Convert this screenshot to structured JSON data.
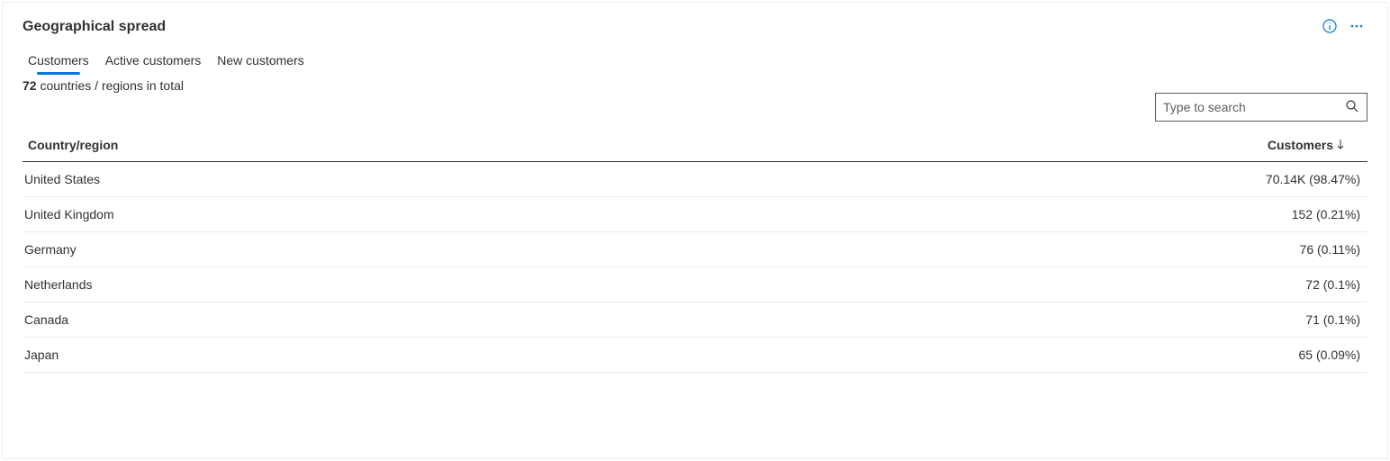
{
  "header": {
    "title": "Geographical spread"
  },
  "tabs": [
    {
      "label": "Customers",
      "active": true
    },
    {
      "label": "Active customers",
      "active": false
    },
    {
      "label": "New customers",
      "active": false
    }
  ],
  "summary": {
    "count": "72",
    "suffix": " countries / regions in total"
  },
  "search": {
    "placeholder": "Type to search"
  },
  "table": {
    "columns": {
      "left": "Country/region",
      "right": "Customers"
    },
    "sort": {
      "column": "right",
      "dir": "desc"
    },
    "rows": [
      {
        "country": "United States",
        "value": "70.14K (98.47%)"
      },
      {
        "country": "United Kingdom",
        "value": "152 (0.21%)"
      },
      {
        "country": "Germany",
        "value": "76 (0.11%)"
      },
      {
        "country": "Netherlands",
        "value": "72 (0.1%)"
      },
      {
        "country": "Canada",
        "value": "71 (0.1%)"
      },
      {
        "country": "Japan",
        "value": "65 (0.09%)"
      }
    ]
  },
  "icons": {
    "info": "info-icon",
    "more": "more-icon",
    "search": "search-icon",
    "sortDown": "arrow-down-icon"
  },
  "colors": {
    "accent": "#0078d4",
    "border": "#edebe9",
    "text": "#323130"
  }
}
